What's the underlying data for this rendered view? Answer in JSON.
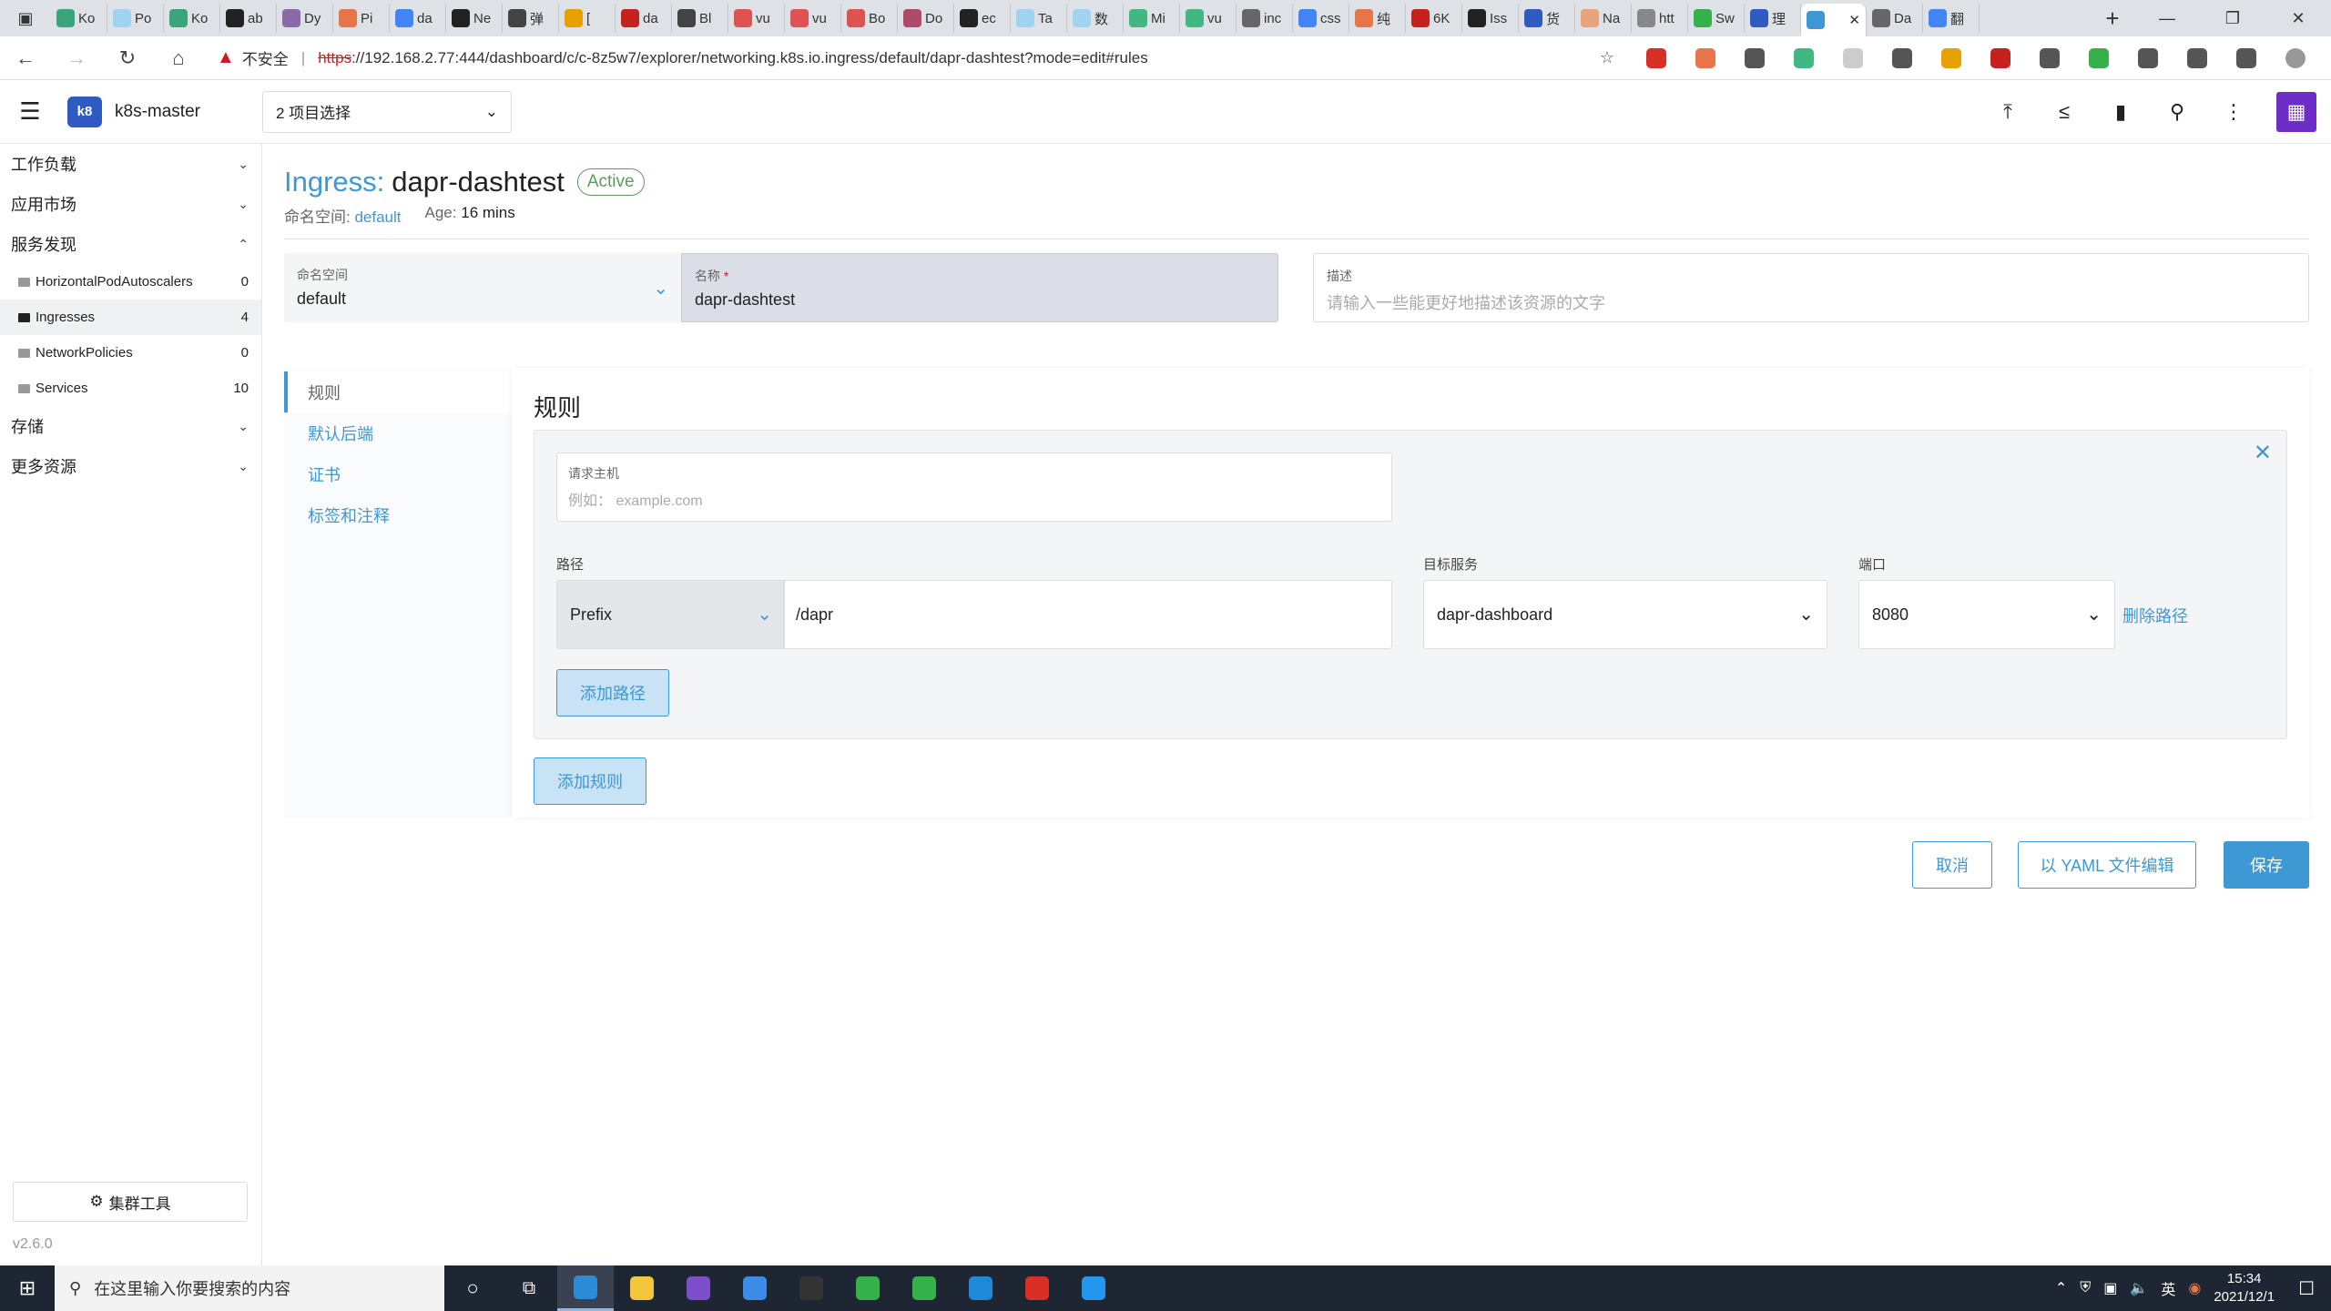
{
  "browser": {
    "tabs": [
      {
        "label": "Ko",
        "color": "#3aa57a"
      },
      {
        "label": "Po",
        "color": "#9fd3f0"
      },
      {
        "label": "Ko",
        "color": "#3aa57a"
      },
      {
        "label": "ab",
        "color": "#222222"
      },
      {
        "label": "Dy",
        "color": "#8a6aa8"
      },
      {
        "label": "Pi",
        "color": "#e8744a"
      },
      {
        "label": "da",
        "color": "#4285f4"
      },
      {
        "label": "Ne",
        "color": "#222222"
      },
      {
        "label": "弹",
        "color": "#444444"
      },
      {
        "label": "[",
        "color": "#e8a000"
      },
      {
        "label": "da",
        "color": "#c5221f"
      },
      {
        "label": "Bl",
        "color": "#444444"
      },
      {
        "label": "vu",
        "color": "#e05252"
      },
      {
        "label": "vu",
        "color": "#e05252"
      },
      {
        "label": "Bo",
        "color": "#e05252"
      },
      {
        "label": "Do",
        "color": "#b04a6a"
      },
      {
        "label": "ec",
        "color": "#222222"
      },
      {
        "label": "Ta",
        "color": "#9fd3f0"
      },
      {
        "label": "数",
        "color": "#9fd3f0"
      },
      {
        "label": "Mi",
        "color": "#41b883"
      },
      {
        "label": "vu",
        "color": "#41b883"
      },
      {
        "label": "inc",
        "color": "#666666"
      },
      {
        "label": "css",
        "color": "#4285f4"
      },
      {
        "label": "纯",
        "color": "#e8744a"
      },
      {
        "label": "6K",
        "color": "#c5221f"
      },
      {
        "label": "Iss",
        "color": "#222222"
      },
      {
        "label": "货",
        "color": "#2f5ac2"
      },
      {
        "label": "Na",
        "color": "#e8a37a"
      },
      {
        "label": "htt",
        "color": "#888888"
      },
      {
        "label": "Sw",
        "color": "#35b04a"
      },
      {
        "label": "理",
        "color": "#2f5ac2"
      },
      {
        "label": "",
        "color": "#3d98d3",
        "active": true
      },
      {
        "label": "Da",
        "color": "#666666"
      },
      {
        "label": "翻",
        "color": "#4285f4"
      }
    ],
    "url_warning": "不安全",
    "url_scheme": "https",
    "url_rest": "://192.168.2.77:444/dashboard/c/c-8z5w7/explorer/networking.k8s.io.ingress/default/dapr-dashtest?mode=edit#rules",
    "extension_colors": [
      "#d93025",
      "#e8744a",
      "#555555",
      "#41b883",
      "#cccccc",
      "#555555",
      "#e8a000",
      "#c5221f",
      "#555555",
      "#35b04a",
      "#555555",
      "#555555",
      "#555555",
      "#999999"
    ]
  },
  "header": {
    "cluster_name": "k8s-master",
    "project_select": "2 项目选择"
  },
  "sidebar": {
    "groups": [
      {
        "label": "工作负载",
        "expanded": false
      },
      {
        "label": "应用市场",
        "expanded": false
      },
      {
        "label": "服务发现",
        "expanded": true
      }
    ],
    "items": [
      {
        "label": "HorizontalPodAutoscalers",
        "count": "0"
      },
      {
        "label": "Ingresses",
        "count": "4",
        "active": true
      },
      {
        "label": "NetworkPolicies",
        "count": "0"
      },
      {
        "label": "Services",
        "count": "10"
      }
    ],
    "groups_after": [
      {
        "label": "存储"
      },
      {
        "label": "更多资源"
      }
    ],
    "cluster_tools": "集群工具",
    "version": "v2.6.0"
  },
  "page": {
    "title_prefix": "Ingress:",
    "title_name": "dapr-dashtest",
    "status": "Active",
    "namespace_label": "命名空间:",
    "namespace_value": "default",
    "age_label": "Age:",
    "age_value": "16 mins"
  },
  "form": {
    "namespace_label": "命名空间",
    "namespace_value": "default",
    "name_label": "名称",
    "name_required": "*",
    "name_value": "dapr-dashtest",
    "description_label": "描述",
    "description_placeholder": "请输入一些能更好地描述该资源的文字"
  },
  "tabs": [
    {
      "label": "规则",
      "active": true
    },
    {
      "label": "默认后端"
    },
    {
      "label": "证书"
    },
    {
      "label": "标签和注释"
    }
  ],
  "rules": {
    "heading": "规则",
    "host_label": "请求主机",
    "host_placeholder": "例如： example.com",
    "path_label": "路径",
    "target_label": "目标服务",
    "port_label": "端口",
    "path_type": "Prefix",
    "path_value": "/dapr",
    "service_value": "dapr-dashboard",
    "port_value": "8080",
    "remove_path": "删除路径",
    "add_path": "添加路径",
    "add_rule": "添加规则"
  },
  "actions": {
    "cancel": "取消",
    "yaml": "以 YAML 文件编辑",
    "save": "保存"
  },
  "taskbar": {
    "search_placeholder": "在这里输入你要搜索的内容",
    "apps": [
      {
        "name": "edge",
        "color": "#2b8bd6",
        "active": true
      },
      {
        "name": "explorer",
        "color": "#f3c63c"
      },
      {
        "name": "visual-studio",
        "color": "#7b4fc9"
      },
      {
        "name": "feishu",
        "color": "#3c8ce7"
      },
      {
        "name": "terminal",
        "color": "#333333"
      },
      {
        "name": "gitkraken",
        "color": "#35b04a"
      },
      {
        "name": "maps",
        "color": "#35b04a"
      },
      {
        "name": "vscode",
        "color": "#1f88d8"
      },
      {
        "name": "youdao",
        "color": "#d93025"
      },
      {
        "name": "docker",
        "color": "#2496ed"
      }
    ],
    "ime": "英",
    "time": "15:34",
    "date": "2021/12/1"
  }
}
